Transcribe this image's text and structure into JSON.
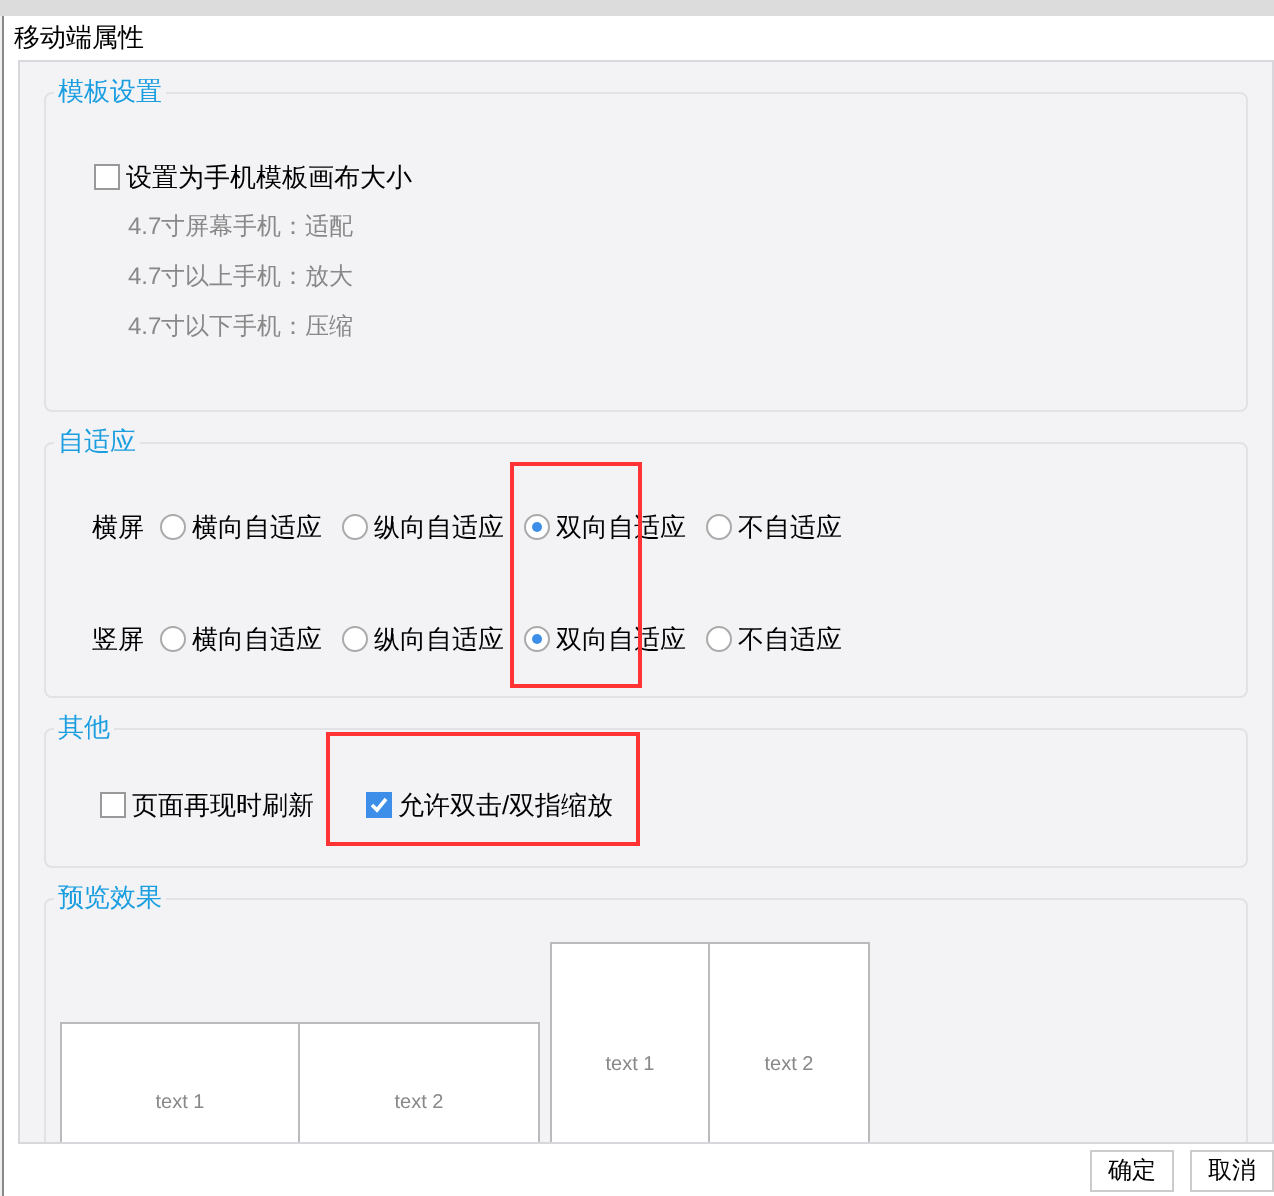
{
  "window": {
    "title": "移动端属性"
  },
  "template_settings": {
    "title": "模板设置",
    "checkbox": {
      "label": "设置为手机模板画布大小",
      "checked": false
    },
    "notes": [
      "4.7寸屏幕手机：适配",
      "4.7寸以上手机：放大",
      "4.7寸以下手机：压缩"
    ]
  },
  "adaptive": {
    "title": "自适应",
    "rows": [
      {
        "label": "横屏",
        "options": [
          {
            "label": "横向自适应",
            "selected": false
          },
          {
            "label": "纵向自适应",
            "selected": false
          },
          {
            "label": "双向自适应",
            "selected": true
          },
          {
            "label": "不自适应",
            "selected": false
          }
        ]
      },
      {
        "label": "竖屏",
        "options": [
          {
            "label": "横向自适应",
            "selected": false
          },
          {
            "label": "纵向自适应",
            "selected": false
          },
          {
            "label": "双向自适应",
            "selected": true
          },
          {
            "label": "不自适应",
            "selected": false
          }
        ]
      }
    ]
  },
  "other": {
    "title": "其他",
    "checkboxes": [
      {
        "label": "页面再现时刷新",
        "checked": false
      },
      {
        "label": "允许双击/双指缩放",
        "checked": true
      }
    ]
  },
  "preview": {
    "title": "预览效果",
    "landscape": [
      "text 1",
      "text 2"
    ],
    "portrait": [
      "text 1",
      "text 2"
    ]
  },
  "buttons": [
    "确定",
    "取消"
  ]
}
